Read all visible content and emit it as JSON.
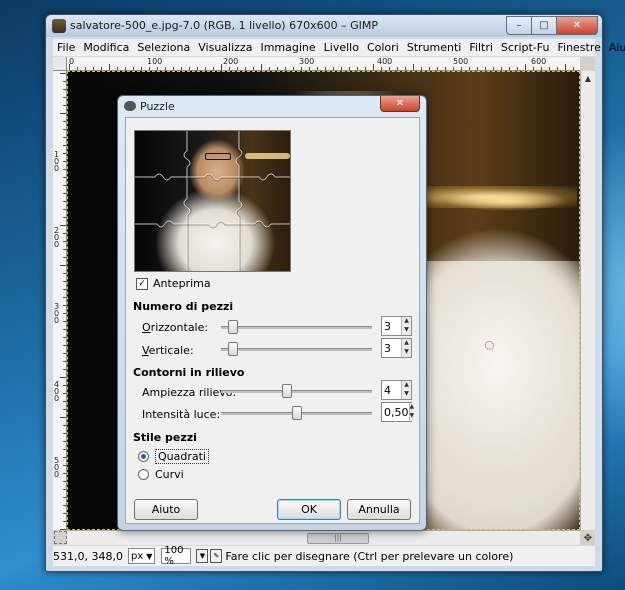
{
  "window": {
    "title": "salvatore-500_e.jpg-7.0 (RGB, 1 livello) 670x600 – GIMP",
    "controls": {
      "minimize": "–",
      "maximize": "□",
      "close": "✕"
    }
  },
  "menubar": {
    "items": [
      "File",
      "Modifica",
      "Seleziona",
      "Visualizza",
      "Immagine",
      "Livello",
      "Colori",
      "Strumenti",
      "Filtri",
      "Script-Fu",
      "Finestre",
      "Aiuto"
    ]
  },
  "rulers": {
    "horizontal": [
      "0",
      "100",
      "200",
      "300",
      "400",
      "500",
      "600"
    ],
    "vertical": [
      "100",
      "200",
      "300",
      "400",
      "500"
    ]
  },
  "statusbar": {
    "coords": "531,0, 348,0",
    "unit": "px",
    "zoom": "100 %",
    "message": "Fare clic per disegnare (Ctrl per prelevare un colore)"
  },
  "dialog": {
    "title": "Puzzle",
    "close": "✕",
    "preview_checkbox": {
      "label": "Anteprima",
      "checked": true
    },
    "section_pieces": "Numero di pezzi",
    "horizontal": {
      "label": "Orizzontale:",
      "value": "3",
      "fraction": 0.05
    },
    "vertical": {
      "label": "Verticale:",
      "value": "3",
      "fraction": 0.05
    },
    "section_bevel": "Contorni in rilievo",
    "bevel_width": {
      "label": "Ampiezza rilievo:",
      "value": "4",
      "fraction": 0.43
    },
    "highlight": {
      "label": "Intensità luce:",
      "value": "0,50",
      "fraction": 0.5
    },
    "section_style": "Stile pezzi",
    "style_options": [
      {
        "label": "Quadrati",
        "selected": true
      },
      {
        "label": "Curvi",
        "selected": false
      }
    ],
    "buttons": {
      "help": "Aiuto",
      "ok": "OK",
      "cancel": "Annulla"
    }
  },
  "icons": {
    "app": "gimp-icon",
    "dialog": "puzzle-filter-icon",
    "navigate": "navigate-icon",
    "quick_mask": "quick-mask-icon"
  }
}
